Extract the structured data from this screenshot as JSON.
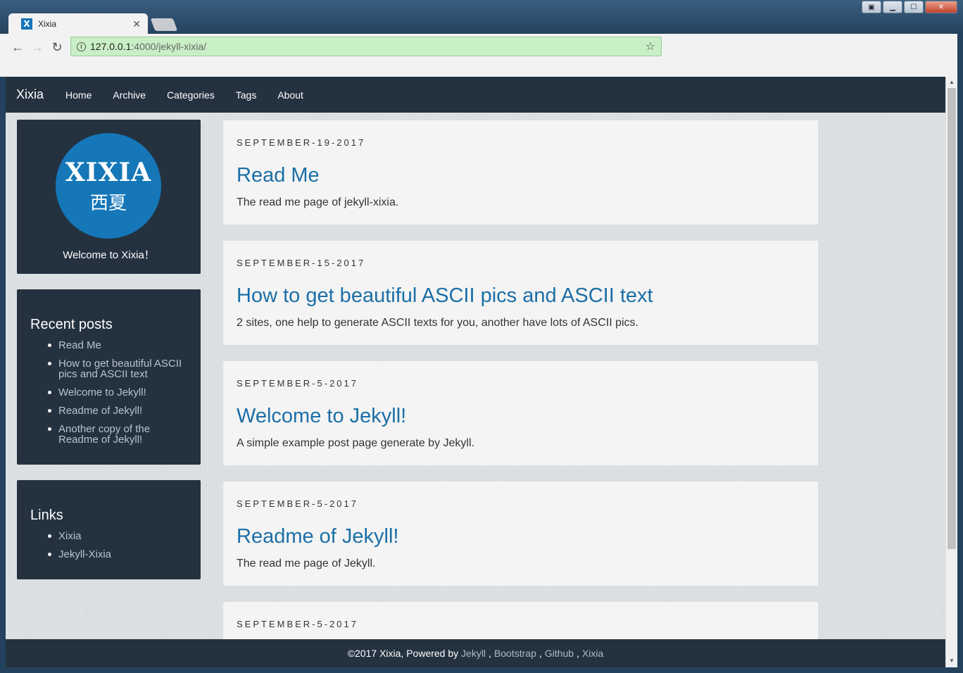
{
  "browser": {
    "tab_title": "Xixia",
    "tab_favicon": "X",
    "url_host": "127.0.0.1",
    "url_rest": ":4000/jekyll-xixia/"
  },
  "navbar": {
    "brand": "Xixia",
    "items": [
      {
        "label": "Home"
      },
      {
        "label": "Archive"
      },
      {
        "label": "Categories"
      },
      {
        "label": "Tags"
      },
      {
        "label": "About"
      }
    ]
  },
  "profile": {
    "logo_text": "XIXIA",
    "logo_sub": "西夏",
    "welcome": "Welcome to Xixia！"
  },
  "recent_posts": {
    "title": "Recent posts",
    "items": [
      {
        "label": "Read Me"
      },
      {
        "label": "How to get beautiful ASCII pics and ASCII text"
      },
      {
        "label": "Welcome to Jekyll!"
      },
      {
        "label": "Readme of Jekyll!"
      },
      {
        "label": "Another copy of the Readme of Jekyll!"
      }
    ]
  },
  "links": {
    "title": "Links",
    "items": [
      {
        "label": "Xixia"
      },
      {
        "label": "Jekyll-Xixia"
      }
    ]
  },
  "posts": [
    {
      "date": "SEPTEMBER-19-2017",
      "title": "Read Me",
      "excerpt": "The read me page of jekyll-xixia."
    },
    {
      "date": "SEPTEMBER-15-2017",
      "title": "How to get beautiful ASCII pics and ASCII text",
      "excerpt": "2 sites, one help to generate ASCII texts for you, another have lots of ASCII pics."
    },
    {
      "date": "SEPTEMBER-5-2017",
      "title": "Welcome to Jekyll!",
      "excerpt": "A simple example post page generate by Jekyll."
    },
    {
      "date": "SEPTEMBER-5-2017",
      "title": "Readme of Jekyll!",
      "excerpt": "The read me page of Jekyll."
    },
    {
      "date": "SEPTEMBER-5-2017",
      "title": "",
      "excerpt": ""
    }
  ],
  "footer": {
    "prefix": "©2017 Xixia, Powered by",
    "links": [
      {
        "label": "Jekyll"
      },
      {
        "label": "Bootstrap"
      },
      {
        "label": "Github"
      },
      {
        "label": "Xixia"
      }
    ]
  },
  "colors": {
    "navbar_bg": "#243240",
    "link_blue": "#1b6fa6",
    "logo_blue": "#1577b8",
    "omnibox_green": "#c9efc6"
  }
}
